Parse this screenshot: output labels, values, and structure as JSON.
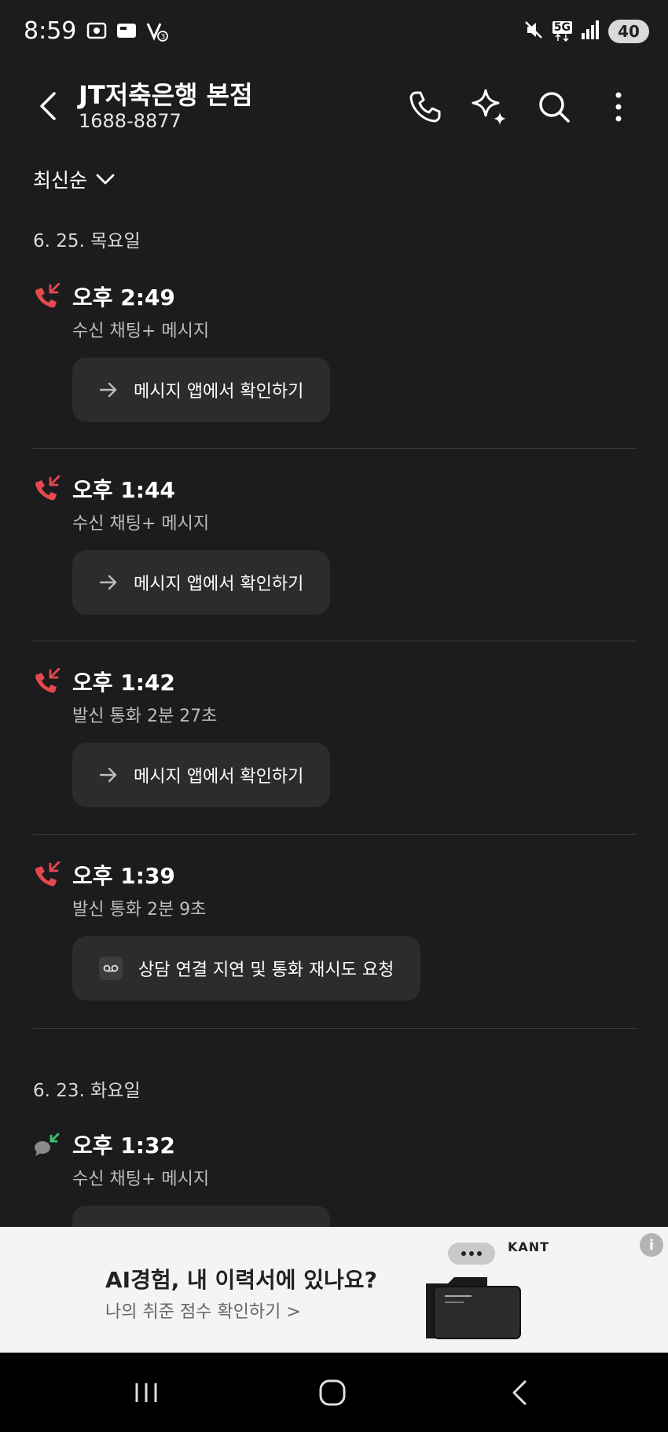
{
  "status_bar": {
    "time": "8:59",
    "network": "5G",
    "battery": "40",
    "icons": [
      "screenshot-icon",
      "card-icon",
      "vpn-icon",
      "mute-icon",
      "network-5g-icon",
      "signal-icon"
    ]
  },
  "header": {
    "contact_name": "JT저축은행 본점",
    "contact_number": "1688-8877",
    "actions": [
      "phone-icon",
      "sparkle-icon",
      "search-icon",
      "more-icon"
    ]
  },
  "sort": {
    "label": "최신순"
  },
  "groups": [
    {
      "date": "6. 25. 목요일",
      "calls": [
        {
          "time": "오후 2:49",
          "desc": "수신 채팅+ 메시지",
          "action": "메시지 앱에서 확인하기",
          "icon": "missed-call-icon"
        },
        {
          "time": "오후 1:44",
          "desc": "수신 채팅+ 메시지",
          "action": "메시지 앱에서 확인하기",
          "icon": "missed-call-icon"
        },
        {
          "time": "오후 1:42",
          "desc": "발신 통화 2분 27초",
          "action": "메시지 앱에서 확인하기",
          "icon": "missed-call-icon"
        },
        {
          "time": "오후 1:39",
          "desc": "발신 통화 2분 9초",
          "action": "상담 연결 지연 및 통화 재시도 요청",
          "icon": "missed-call-icon"
        }
      ]
    },
    {
      "date": "6. 23. 화요일",
      "calls": [
        {
          "time": "오후 1:32",
          "desc": "수신 채팅+ 메시지",
          "action": "",
          "icon": "incoming-chat-icon"
        }
      ]
    }
  ],
  "ad": {
    "title": "AI경험, 내 이력서에 있나요?",
    "subtitle": "나의 취준 점수 확인하기 >",
    "brand": "KANT",
    "info": "i"
  },
  "colors": {
    "background": "#1c1c1e",
    "missed_call": "#e5484d",
    "incoming": "#3ec46d",
    "card": "#2c2c2e"
  }
}
